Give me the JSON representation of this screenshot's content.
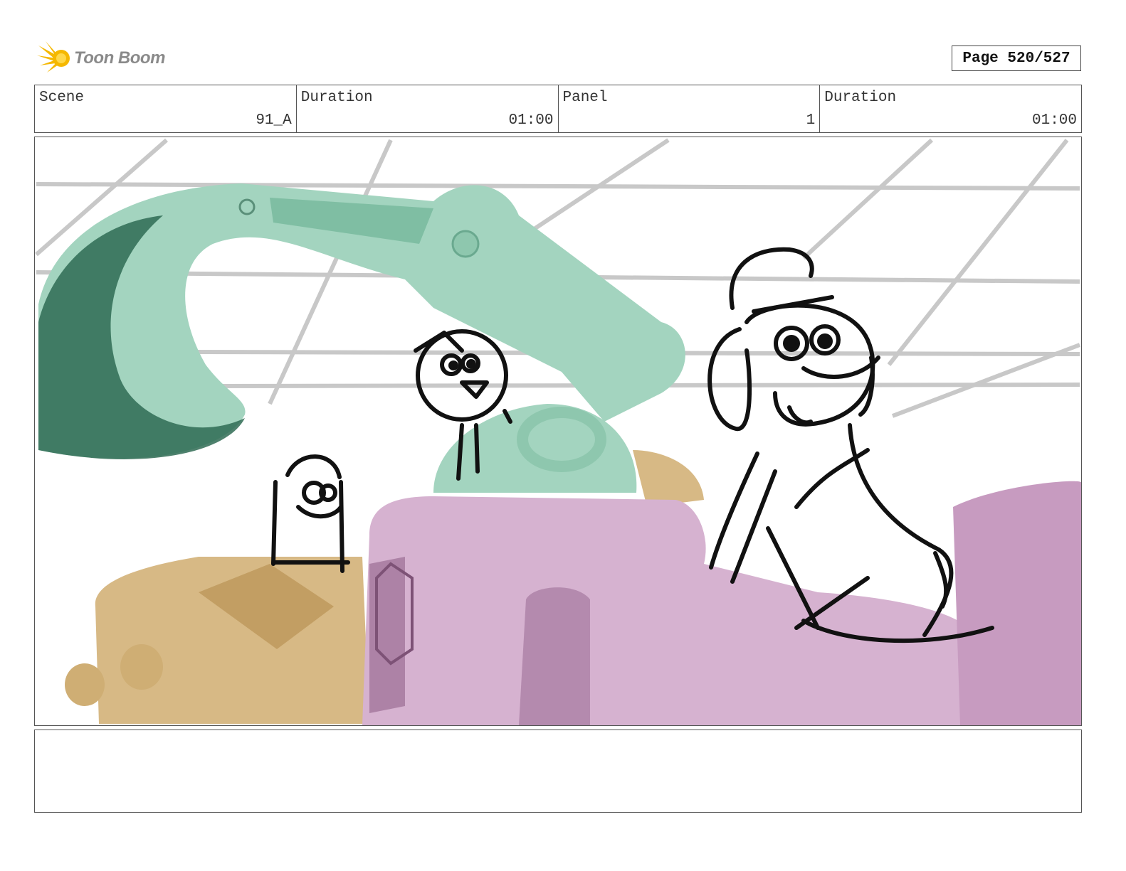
{
  "brand": {
    "name": "Toon Boom",
    "color": "#f5b800"
  },
  "page": {
    "label": "Page 520/527"
  },
  "info": {
    "scene_label": "Scene",
    "scene_value": "91_A",
    "duration_label": "Duration",
    "duration_value": "01:00",
    "panel_label": "Panel",
    "panel_value": "1",
    "panel_duration_label": "Duration",
    "panel_duration_value": "01:00"
  },
  "panel_image": {
    "description_icon": "storyboard-sketch",
    "colors": {
      "arm": "#a3d4bf",
      "arm_dark": "#2f6b54",
      "truck": "#d7b985",
      "vehicle": "#d6b2d0",
      "grid": "#c8c8c8",
      "ink": "#111111"
    }
  },
  "notes": {
    "text": ""
  }
}
